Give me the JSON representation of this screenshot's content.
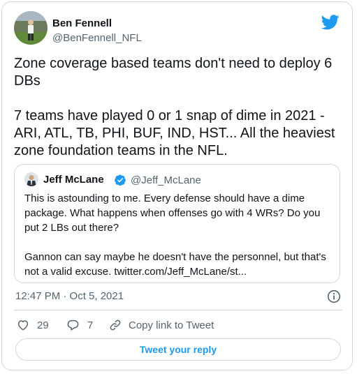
{
  "author": {
    "name": "Ben Fennell",
    "handle": "@BenFennell_NFL",
    "avatar_icon": "profile-photo",
    "platform_icon": "twitter-bird-icon"
  },
  "tweet": {
    "text": "Zone coverage based teams don't need to deploy 6 DBs\n\n7 teams have played 0 or 1 snap of dime in 2021 - ARI, ATL, TB, PHI, BUF, IND, HST... All the heaviest zone foundation teams in the NFL.",
    "timestamp": "12:47 PM · Oct 5, 2021"
  },
  "quoted_tweet": {
    "name": "Jeff McLane",
    "handle": "@Jeff_McLane",
    "verified": true,
    "text": "This is astounding to me. Every defense should have a dime package. What happens when offenses go with 4 WRs? Do you put 2 LBs out there?\n\nGannon can say maybe he doesn't have the personnel, but that's not a valid excuse. twitter.com/Jeff_McLane/st..."
  },
  "actions": {
    "likes": "29",
    "replies": "7",
    "share_label": "Copy link to Tweet"
  },
  "reply_button_label": "Tweet your reply",
  "colors": {
    "accent": "#1d9bf0",
    "text": "#0f1419",
    "muted": "#536471",
    "border": "#cfd9de"
  }
}
